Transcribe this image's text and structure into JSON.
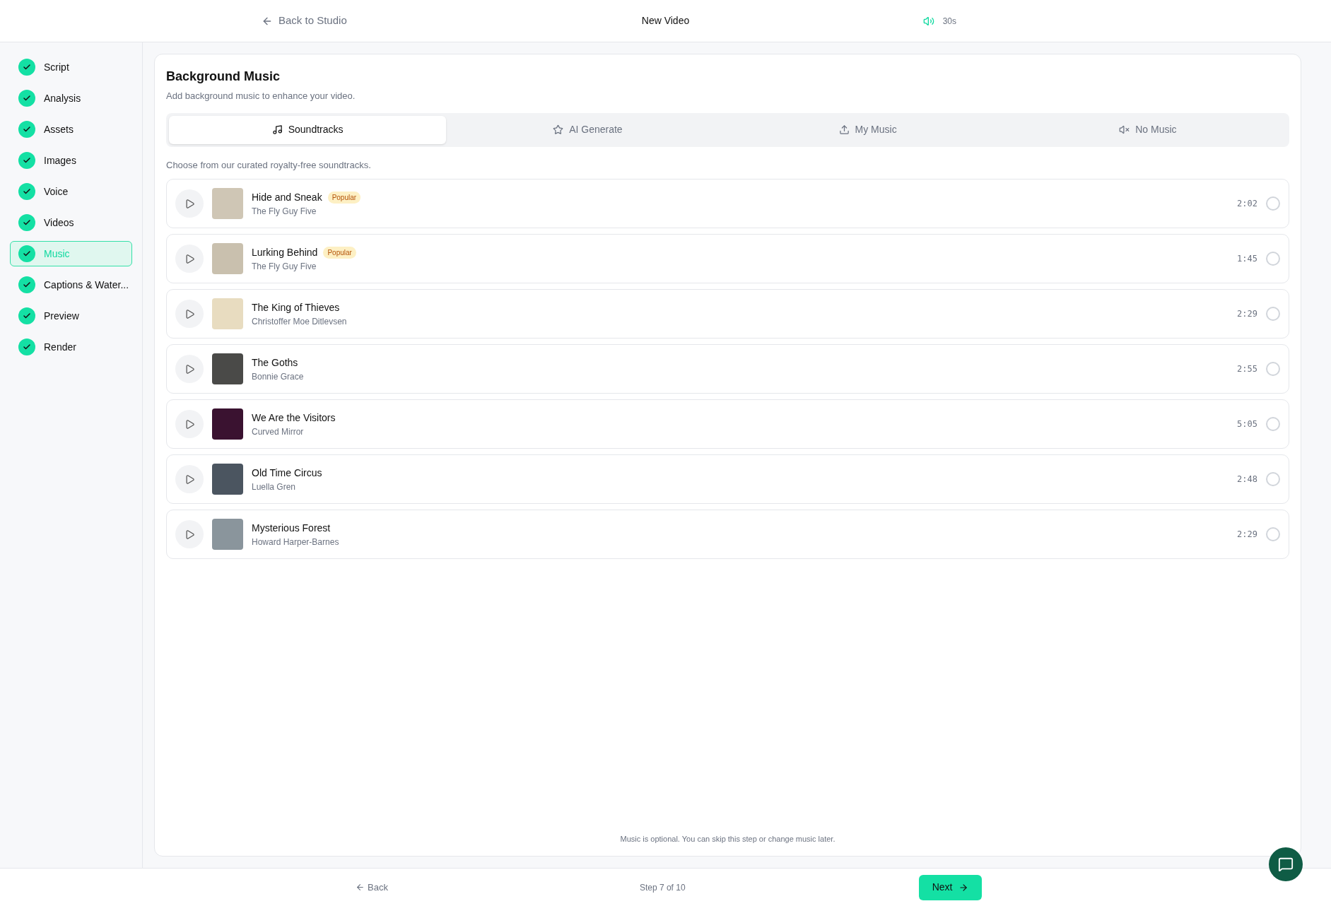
{
  "header": {
    "back_link": "Back to Studio",
    "title": "New Video",
    "duration": "30s"
  },
  "sidebar": {
    "items": [
      {
        "label": "Script",
        "done": true,
        "selected": false
      },
      {
        "label": "Analysis",
        "done": true,
        "selected": false
      },
      {
        "label": "Assets",
        "done": true,
        "selected": false
      },
      {
        "label": "Images",
        "done": true,
        "selected": false
      },
      {
        "label": "Voice",
        "done": true,
        "selected": false
      },
      {
        "label": "Videos",
        "done": true,
        "selected": false
      },
      {
        "label": "Music",
        "done": true,
        "selected": true
      },
      {
        "label": "Captions & Water...",
        "done": true,
        "selected": false
      },
      {
        "label": "Preview",
        "done": true,
        "selected": false
      },
      {
        "label": "Render",
        "done": true,
        "selected": false
      }
    ]
  },
  "panel": {
    "title": "Background Music",
    "subtitle": "Add background music to enhance your video.",
    "tabs": [
      {
        "label": "Soundtracks",
        "kind": "music",
        "selected": true
      },
      {
        "label": "AI Generate",
        "kind": "star",
        "selected": false
      },
      {
        "label": "My Music",
        "kind": "upload",
        "selected": false
      },
      {
        "label": "No Music",
        "kind": "mute",
        "selected": false
      }
    ],
    "hint": "Choose from our curated royalty-free soundtracks.",
    "tracks": [
      {
        "title": "Hide and Sneak",
        "artist": "The Fly Guy Five",
        "badge": "Popular",
        "duration": "2:02",
        "selected": false
      },
      {
        "title": "Lurking Behind",
        "artist": "The Fly Guy Five",
        "badge": "Popular",
        "duration": "1:45",
        "selected": false
      },
      {
        "title": "The King of Thieves",
        "artist": "Christoffer Moe Ditlevsen",
        "duration": "2:29",
        "selected": false
      },
      {
        "title": "The Goths",
        "artist": "Bonnie Grace",
        "duration": "2:55",
        "selected": false
      },
      {
        "title": "We Are the Visitors",
        "artist": "Curved Mirror",
        "duration": "5:05",
        "selected": false
      },
      {
        "title": "Old Time Circus",
        "artist": "Luella Gren",
        "duration": "2:48",
        "selected": false
      },
      {
        "title": "Mysterious Forest",
        "artist": "Howard Harper-Barnes",
        "duration": "2:29",
        "selected": false
      }
    ],
    "footnote": "Music is optional. You can skip this step or change music later."
  },
  "footer": {
    "back": "Back",
    "step": "Step 7 of 10",
    "next": "Next"
  }
}
